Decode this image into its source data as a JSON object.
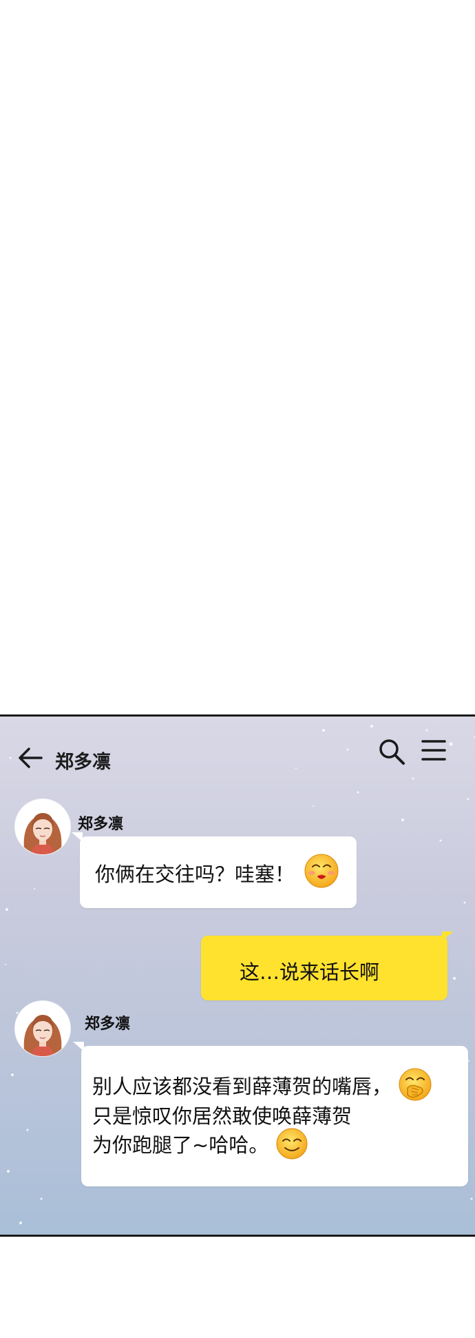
{
  "header": {
    "title": "郑多凛"
  },
  "messages": [
    {
      "sender": "郑多凛",
      "text": "你俩在交往吗？哇塞！",
      "emoji": "kissing-face-icon"
    },
    {
      "sender": "me",
      "text": "这…说来话长啊"
    },
    {
      "sender": "郑多凛",
      "lines": [
        "别人应该都没看到薛薄贺的嘴唇，",
        "只是惊叹你居然敢使唤薛薄贺",
        "为你跑腿了~哈哈。"
      ],
      "emojis": [
        "face-with-hand-over-mouth-icon",
        "smiling-face-icon"
      ]
    }
  ],
  "colors": {
    "my_bubble": "#ffe22e",
    "their_bubble": "#ffffff",
    "panel_top": "#d9d8e6",
    "panel_bottom": "#a9bfd8"
  }
}
